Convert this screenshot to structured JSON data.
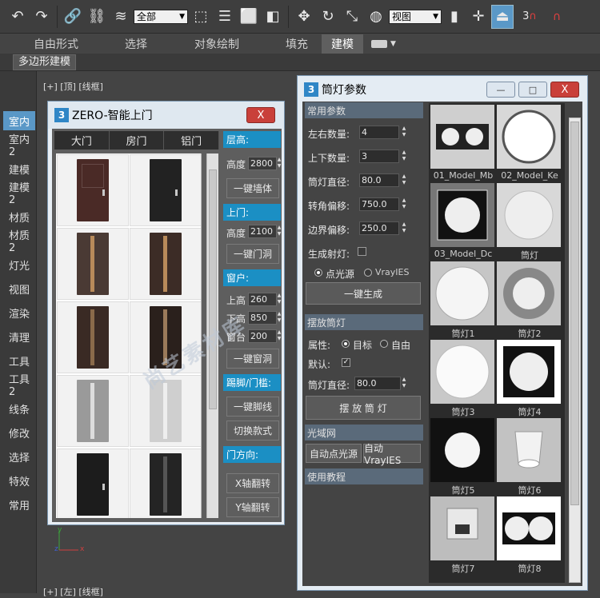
{
  "toolbar": {
    "select_mode": "全部",
    "view_mode": "视图",
    "snap_label": "3"
  },
  "ribbon": {
    "tabs": [
      "自由形式",
      "选择",
      "对象绘制",
      "填充",
      "建模"
    ],
    "active_tab": "建模"
  },
  "subbar": {
    "tab": "多边形建模"
  },
  "viewports": {
    "top_label": "[+] [顶] [线框]",
    "bottom_label": "[+] [左] [线框]",
    "axis_y": "y",
    "axis_x": "x",
    "axis_z": "z"
  },
  "left_panel": {
    "items": [
      "室内",
      "室内2",
      "建模",
      "建模2",
      "材质",
      "材质2",
      "灯光",
      "视图",
      "渲染",
      "清理",
      "工具",
      "工具2",
      "线条",
      "修改",
      "选择",
      "特效",
      "常用"
    ],
    "active": "室内"
  },
  "zero_window": {
    "logo_text": "3",
    "title": "ZERO-智能上门",
    "close": "X",
    "tabs": [
      "大门",
      "房门",
      "铝门"
    ],
    "watermark": "尚艺素材库",
    "sections": {
      "floor_height": {
        "heading": "层高:",
        "label": "高度",
        "value": "2800",
        "button": "一键墙体"
      },
      "door": {
        "heading": "上门:",
        "label": "高度",
        "value": "2100",
        "button": "一键门洞"
      },
      "window": {
        "heading": "窗户:",
        "fields": [
          {
            "label": "上高",
            "value": "260"
          },
          {
            "label": "下高",
            "value": "850"
          },
          {
            "label": "窗台",
            "value": "200"
          }
        ],
        "button": "一键窗洞"
      },
      "skirting": {
        "heading": "踢脚/门槛:",
        "buttons": [
          "一键脚线",
          "切换款式"
        ]
      },
      "direction": {
        "heading": "门方向:",
        "buttons": [
          "X轴翻转",
          "Y轴翻转"
        ]
      }
    }
  },
  "tong_window": {
    "logo_text": "3",
    "title": "筒灯参数",
    "minimize": "—",
    "maximize": "□",
    "close": "X",
    "common": {
      "heading": "常用参数",
      "fields": [
        {
          "label": "左右数量:",
          "value": "4"
        },
        {
          "label": "上下数量:",
          "value": "3"
        },
        {
          "label": "筒灯直径:",
          "value": "80.0"
        },
        {
          "label": "转角偏移:",
          "value": "750.0"
        },
        {
          "label": "边界偏移:",
          "value": "250.0"
        }
      ],
      "gen_light_label": "生成射灯:",
      "radio_point": "点光源",
      "radio_vray": "VrayIES",
      "button": "一键生成"
    },
    "place": {
      "heading": "摆放筒灯",
      "attr_label": "属性:",
      "attr_target": "目标",
      "attr_free": "自由",
      "default_label": "默认:",
      "dia_label": "筒灯直径:",
      "dia_value": "80.0",
      "button": "摆 放 筒 灯"
    },
    "photometric": {
      "heading": "光域网",
      "buttons": [
        "自动点光源",
        "自动VrayIES"
      ]
    },
    "tutorial": {
      "heading": "使用教程"
    },
    "thumbnails": [
      "01_Model_Mb",
      "02_Model_Ke",
      "03_Model_Dc",
      "筒灯",
      "筒灯1",
      "筒灯2",
      "筒灯3",
      "筒灯4",
      "筒灯5",
      "筒灯6",
      "筒灯7",
      "筒灯8"
    ]
  },
  "colors": {
    "accent_blue": "#1b8fc4",
    "active_side": "#5a98c7",
    "close_red": "#c9403a"
  }
}
